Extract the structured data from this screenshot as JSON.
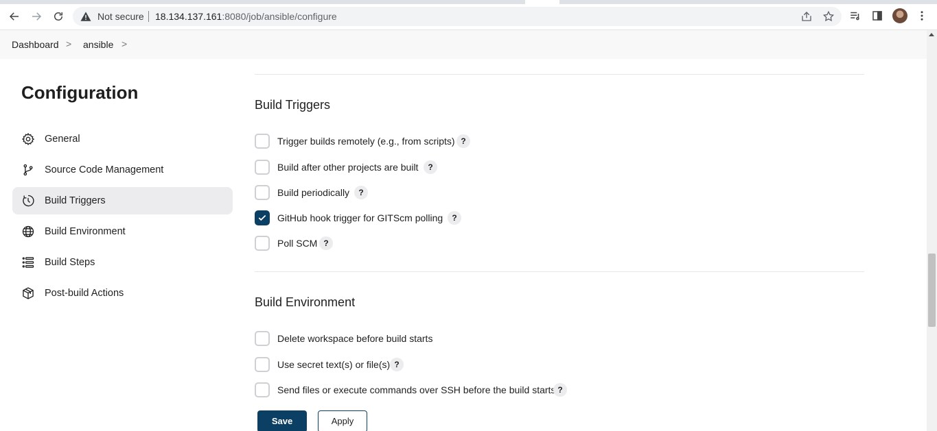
{
  "browser": {
    "security_label": "Not secure",
    "url_host": "18.134.137.161",
    "url_rest": ":8080/job/ansible/configure"
  },
  "breadcrumb": {
    "items": [
      "Dashboard",
      "ansible"
    ],
    "separator": ">"
  },
  "sidebar": {
    "title": "Configuration",
    "items": [
      {
        "label": "General",
        "icon": "gear-icon"
      },
      {
        "label": "Source Code Management",
        "icon": "git-branch-icon"
      },
      {
        "label": "Build Triggers",
        "icon": "clock-icon",
        "active": true
      },
      {
        "label": "Build Environment",
        "icon": "globe-icon"
      },
      {
        "label": "Build Steps",
        "icon": "list-icon"
      },
      {
        "label": "Post-build Actions",
        "icon": "package-icon"
      }
    ]
  },
  "build_triggers": {
    "title": "Build Triggers",
    "options": [
      {
        "label": "Trigger builds remotely (e.g., from scripts)",
        "checked": false,
        "help": "?"
      },
      {
        "label": "Build after other projects are built",
        "checked": false,
        "help": "?"
      },
      {
        "label": "Build periodically",
        "checked": false,
        "help": "?"
      },
      {
        "label": "GitHub hook trigger for GITScm polling",
        "checked": true,
        "help": "?"
      },
      {
        "label": "Poll SCM",
        "checked": false,
        "help": "?"
      }
    ]
  },
  "build_environment": {
    "title": "Build Environment",
    "options": [
      {
        "label": "Delete workspace before build starts",
        "checked": false
      },
      {
        "label": "Use secret text(s) or file(s)",
        "checked": false,
        "help": "?"
      },
      {
        "label": "Send files or execute commands over SSH before the build starts",
        "checked": false,
        "help": "?"
      }
    ]
  },
  "actions": {
    "save_label": "Save",
    "apply_label": "Apply"
  },
  "colors": {
    "primary": "#0b3f63",
    "active_bg": "#ececef"
  }
}
